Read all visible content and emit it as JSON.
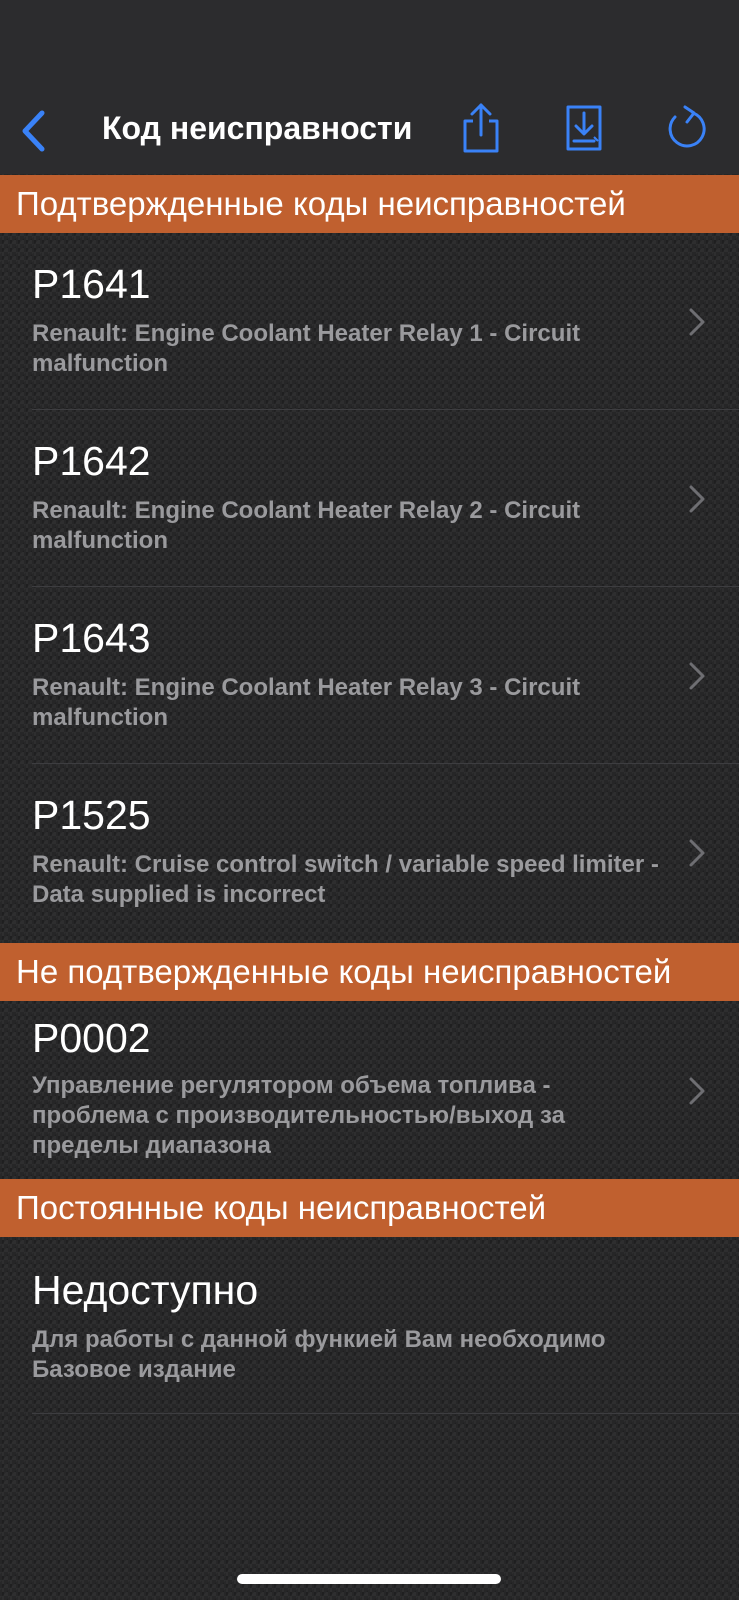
{
  "nav": {
    "title": "Код неисправности",
    "icons": {
      "back": "chevron-left-icon",
      "share": "share-icon",
      "save": "download-doc-icon",
      "refresh": "refresh-icon"
    },
    "accent_color": "#3a82f7"
  },
  "sections": {
    "confirmed": {
      "title": "Подтвержденные коды неисправностей",
      "items": [
        {
          "code": "P1641",
          "desc": "Renault: Engine Coolant Heater Relay 1 - Circuit malfunction"
        },
        {
          "code": "P1642",
          "desc": "Renault: Engine Coolant Heater Relay 2 - Circuit malfunction"
        },
        {
          "code": "P1643",
          "desc": "Renault: Engine Coolant Heater Relay 3 - Circuit malfunction"
        },
        {
          "code": "P1525",
          "desc": "Renault: Cruise control switch / variable speed limiter - Data supplied is incorrect"
        }
      ]
    },
    "unconfirmed": {
      "title": "Не подтвержденные коды неисправностей",
      "items": [
        {
          "code": "P0002",
          "desc": "Управление регулятором объема топлива - проблема с производительностью/выход за пределы диапазона"
        }
      ]
    },
    "permanent": {
      "title": "Постоянные коды неисправностей",
      "items": [
        {
          "code": "Недоступно",
          "desc": "Для работы с данной функией Вам необходимо Базовое издание"
        }
      ]
    }
  },
  "colors": {
    "section_header": "#c0602f",
    "description_text": "#9a9a9d"
  }
}
